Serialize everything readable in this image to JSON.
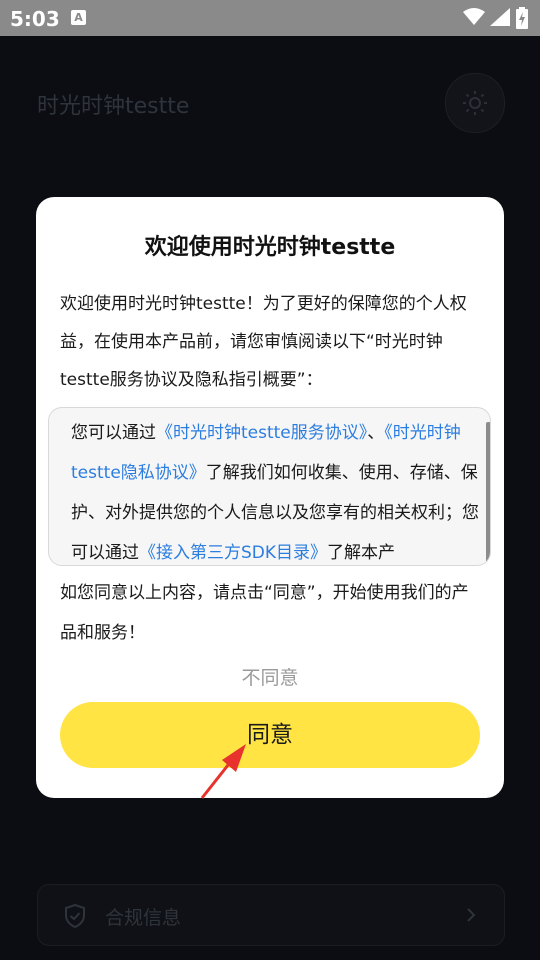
{
  "status_bar": {
    "time": "5:03",
    "notification_letter": "A"
  },
  "app": {
    "title": "时光时钟testte",
    "theme_icon": "sun-icon",
    "compliance_label": "合规信息"
  },
  "dialog": {
    "title": "欢迎使用时光时钟testte",
    "intro": "欢迎使用时光时钟testte！为了更好的保障您的个人权益，在使用本产品前，请您审慎阅读以下“时光时钟testte服务协议及隐私指引概要”：",
    "box": {
      "text1": "您可以通过",
      "link_service": "《时光时钟testte服务协议》",
      "text2": "、",
      "link_privacy": "《时光时钟testte隐私协议》",
      "text3": "了解我们如何收集、使用、存储、保护、对外提供您的个人信息以及您享有的相关权利；您可以通过",
      "link_sdk": "《接入第三方SDK目录》",
      "text4": "了解本产"
    },
    "outro": "如您同意以上内容，请点击“同意”，开始使用我们的产品和服务！",
    "disagree_label": "不同意",
    "agree_label": "同意"
  },
  "colors": {
    "accent_yellow": "#ffe443",
    "link_blue": "#2b7de0",
    "annotation_red": "#e8322d"
  }
}
